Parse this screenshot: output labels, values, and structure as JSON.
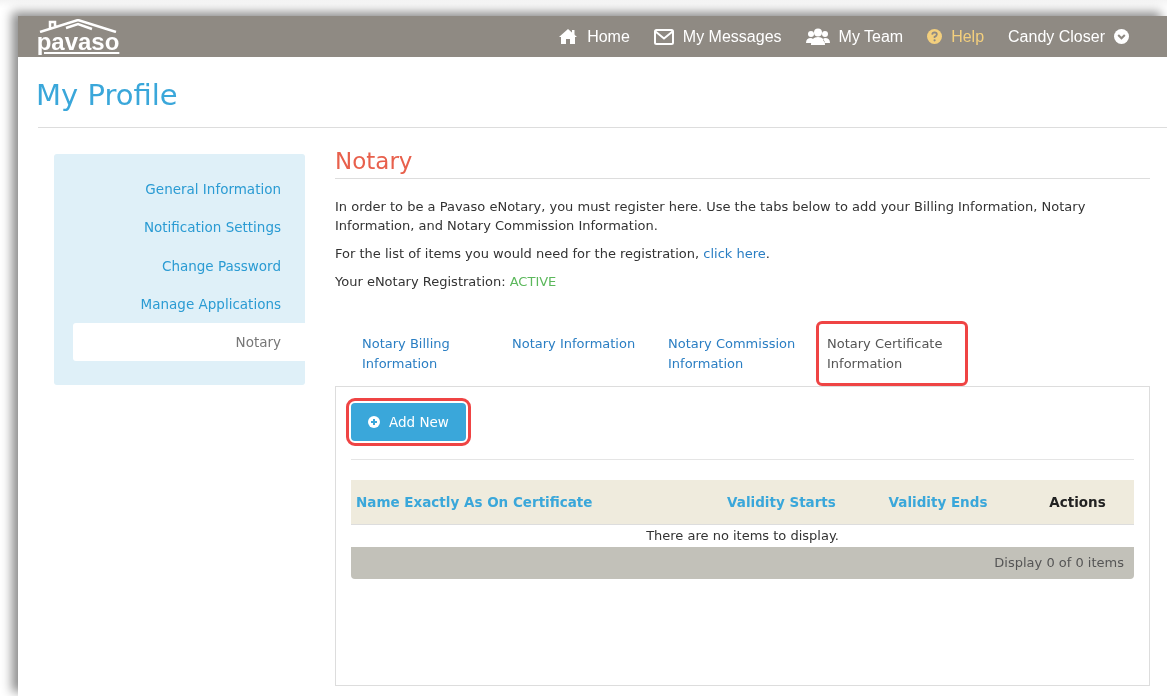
{
  "navbar": {
    "logo": "pavaso",
    "items": [
      {
        "kind": "home",
        "label": "Home"
      },
      {
        "kind": "messages",
        "label": "My Messages"
      },
      {
        "kind": "team",
        "label": "My Team"
      },
      {
        "kind": "help",
        "label": "Help"
      },
      {
        "kind": "user",
        "label": "Candy Closer"
      }
    ]
  },
  "page_title": "My Profile",
  "sidebar": {
    "items": [
      {
        "label": "General Information",
        "selected": false
      },
      {
        "label": "Notification Settings",
        "selected": false
      },
      {
        "label": "Change Password",
        "selected": false
      },
      {
        "label": "Manage Applications",
        "selected": false
      },
      {
        "label": "Notary",
        "selected": true
      }
    ]
  },
  "section_title": "Notary",
  "intro": "In order to be a Pavaso eNotary, you must register here. Use the tabs below to add your Billing Information, Notary Information, and Notary Commission Information.",
  "list_note": {
    "text": "For the list of items you would need for the registration,",
    "link": "click here",
    "after": "."
  },
  "registration": {
    "label": "Your eNotary Registration:",
    "status": "ACTIVE"
  },
  "tabs": [
    {
      "label": "Notary Billing Information",
      "selected": false,
      "highlighted": false
    },
    {
      "label": "Notary Information",
      "selected": false,
      "highlighted": false
    },
    {
      "label": "Notary Commission Information",
      "selected": false,
      "highlighted": false
    },
    {
      "label": "Notary Certificate Information",
      "selected": true,
      "highlighted": true
    }
  ],
  "add_button": {
    "label": "Add New",
    "highlighted": true
  },
  "table": {
    "columns": [
      {
        "label": "Name Exactly As On Certificate",
        "sortable": true
      },
      {
        "label": "Validity Starts",
        "sortable": true
      },
      {
        "label": "Validity Ends",
        "sortable": true
      },
      {
        "label": "Actions",
        "sortable": false
      }
    ],
    "empty_message": "There are no items to display.",
    "footer": "Display 0 of 0 items"
  }
}
